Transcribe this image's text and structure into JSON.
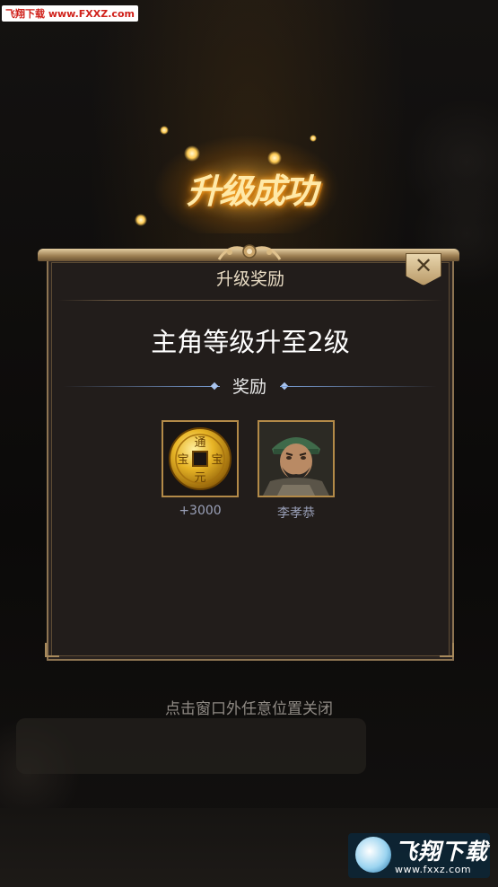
{
  "watermark_top": "飞翔下载 www.FXXZ.com",
  "level_up_title": "升级成功",
  "dialog": {
    "title": "升级奖励",
    "close_symbol": "✕",
    "message": "主角等级升至2级",
    "reward_section_label": "奖励",
    "rewards": [
      {
        "icon": "copper-coin-icon",
        "caption": "+3000",
        "coin_text": [
          "通",
          "宝",
          "元",
          "宝"
        ]
      },
      {
        "icon": "general-portrait",
        "caption": "李孝恭"
      }
    ]
  },
  "hint": "点击窗口外任意位置关闭",
  "watermark_bottom": {
    "text": "飞翔下载",
    "url": "www.fxxz.com"
  },
  "colors": {
    "dialog_bg": "#221d1b",
    "dialog_border": "#8d7452",
    "gold": "#b38a48",
    "divider_blue": "#7ba0d8"
  }
}
